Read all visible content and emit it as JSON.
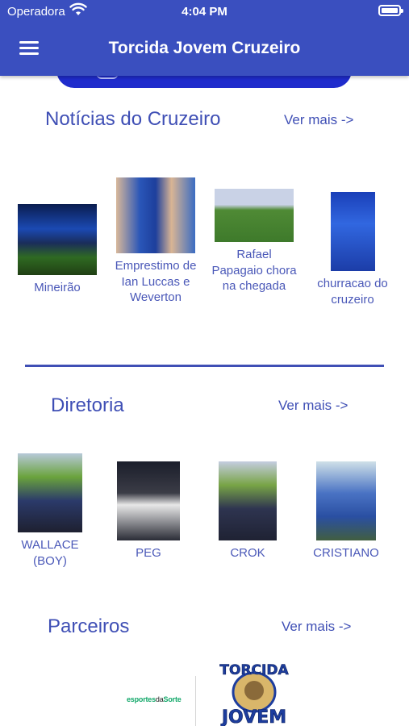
{
  "status_bar": {
    "carrier": "Operadora",
    "time": "4:04 PM"
  },
  "header": {
    "title": "Torcida Jovem Cruzeiro"
  },
  "news": {
    "title": "Notícias do Cruzeiro",
    "see_more": "Ver mais ->",
    "items": [
      {
        "caption": "Mineirão"
      },
      {
        "caption": "Emprestimo de Ian Luccas e Weverton"
      },
      {
        "caption": "Rafael Papagaio chora na chegada"
      },
      {
        "caption": "churracao do cruzeiro"
      }
    ]
  },
  "board": {
    "title": "Diretoria",
    "see_more": "Ver mais ->",
    "members": [
      {
        "name": "WALLACE (BOY)"
      },
      {
        "name": "PEG"
      },
      {
        "name": "CROK"
      },
      {
        "name": "CRISTIANO"
      }
    ]
  },
  "partners": {
    "title": "Parceiros",
    "see_more": "Ver mais ->",
    "sponsor_1": {
      "brand_a": "esportes",
      "brand_b": "da",
      "brand_c": "Sorte"
    },
    "sponsor_2": {
      "top": "TORCIDA",
      "bottom": "JOVEM"
    }
  },
  "colors": {
    "primary": "#3a4fbf",
    "text": "#3f4fb5",
    "banner": "#1f2ccc"
  }
}
